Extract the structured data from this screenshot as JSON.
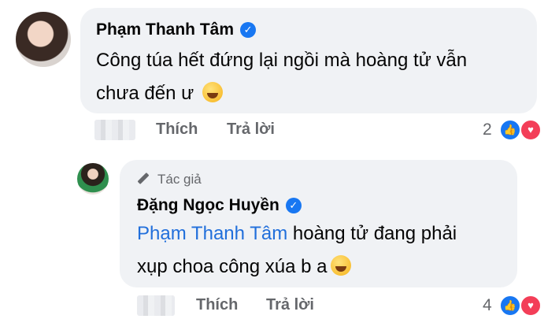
{
  "comment1": {
    "author": "Phạm Thanh Tâm",
    "line1": "Công túa hết đứng lại ngồi mà hoàng tử vẫn",
    "line2": "chưa đến ư",
    "like_label": "Thích",
    "reply_label": "Trả lời",
    "reaction_count": "2"
  },
  "comment2": {
    "author_badge": "Tác giả",
    "author": "Đặng Ngọc Huyền",
    "mention": "Phạm Thanh Tâm",
    "line1_rest": " hoàng tử đang phải",
    "line2": "xụp choa công xúa b a",
    "like_label": "Thích",
    "reply_label": "Trả lời",
    "reaction_count": "4"
  },
  "icons": {
    "verified": "verified-check-icon",
    "emoji": "rolling-laughing-emoji-icon",
    "like": "like-reaction-icon",
    "love": "love-reaction-icon",
    "author": "pen-icon"
  },
  "colors": {
    "bubble": "#f0f2f5",
    "mention": "#216fdb",
    "verified": "#1877f2",
    "secondary_text": "#65676b"
  }
}
